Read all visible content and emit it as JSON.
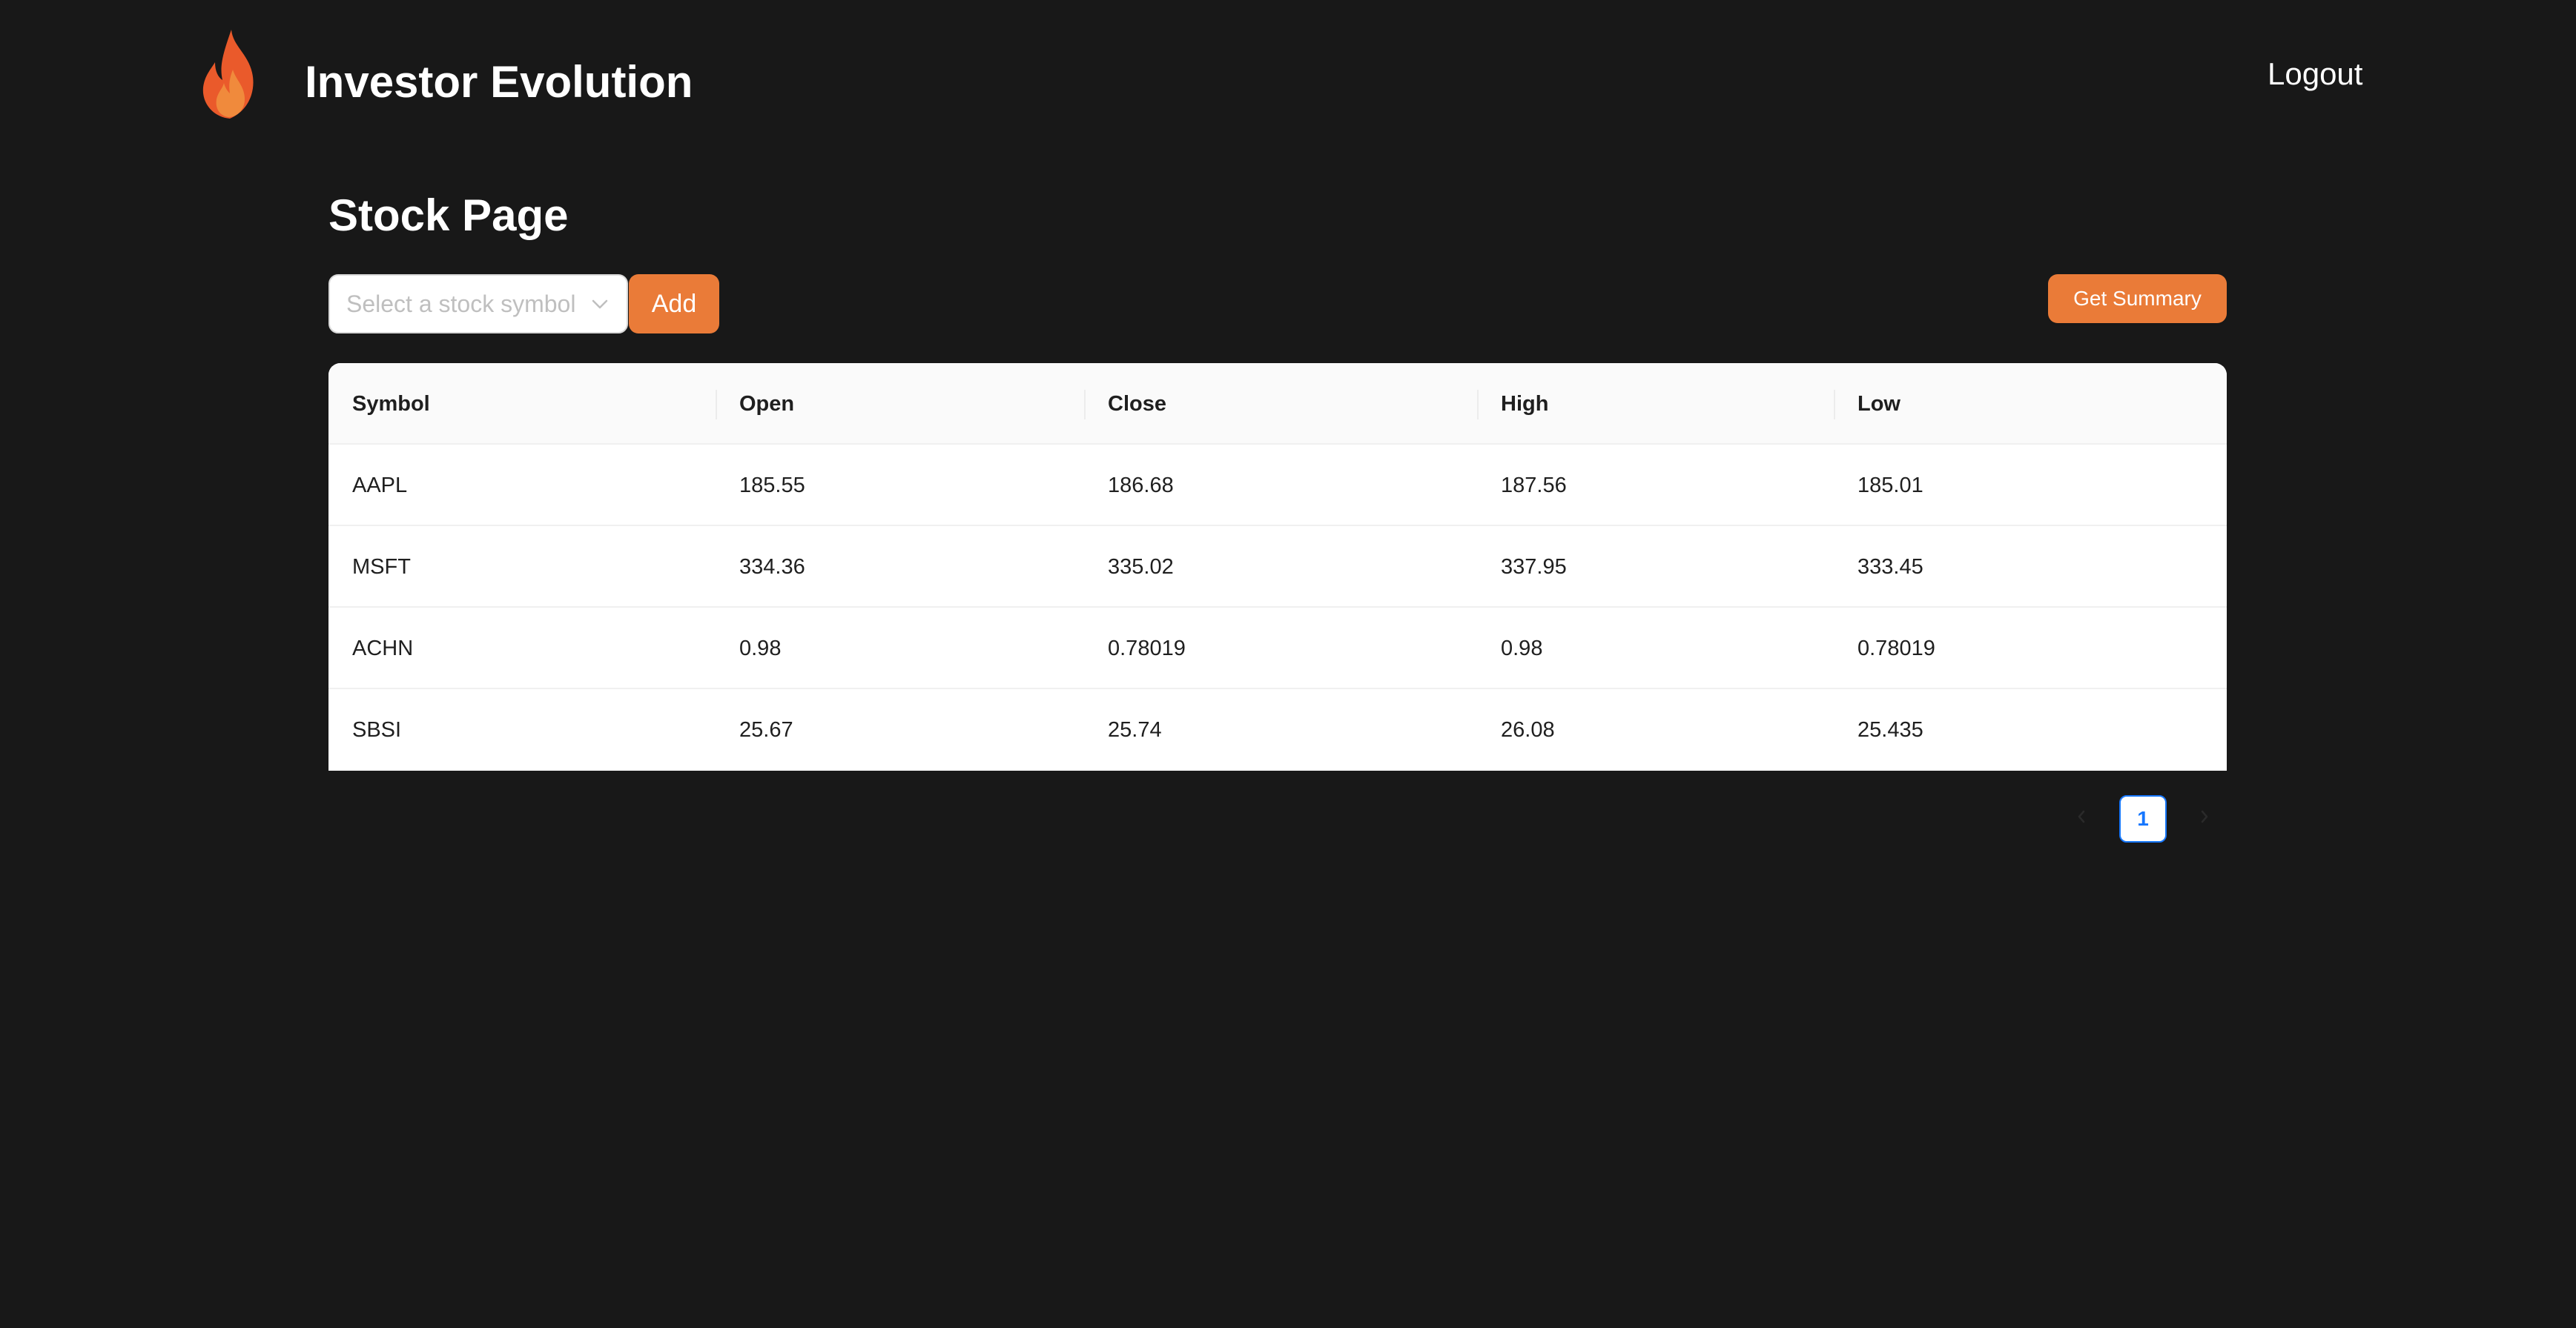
{
  "header": {
    "app_title": "Investor Evolution",
    "logout_label": "Logout",
    "logo_icon": "flame-icon",
    "logo_colors": {
      "outer": "#ea5a2b",
      "inner": "#f08a3c"
    }
  },
  "page": {
    "title": "Stock Page",
    "symbol_select": {
      "placeholder": "Select a stock symbol",
      "icon": "chevron-down-icon"
    },
    "add_label": "Add",
    "summary_label": "Get Summary"
  },
  "table": {
    "columns": [
      "Symbol",
      "Open",
      "Close",
      "High",
      "Low"
    ],
    "rows": [
      [
        "AAPL",
        "185.55",
        "186.68",
        "187.56",
        "185.01"
      ],
      [
        "MSFT",
        "334.36",
        "335.02",
        "337.95",
        "333.45"
      ],
      [
        "ACHN",
        "0.98",
        "0.78019",
        "0.98",
        "0.78019"
      ],
      [
        "SBSI",
        "25.67",
        "25.74",
        "26.08",
        "25.435"
      ]
    ]
  },
  "pagination": {
    "current_page": "1",
    "prev_icon": "chevron-left-icon",
    "next_icon": "chevron-right-icon"
  },
  "colors": {
    "background": "#181818",
    "accent": "#ea7b38",
    "pagination_active": "#1677ff"
  }
}
